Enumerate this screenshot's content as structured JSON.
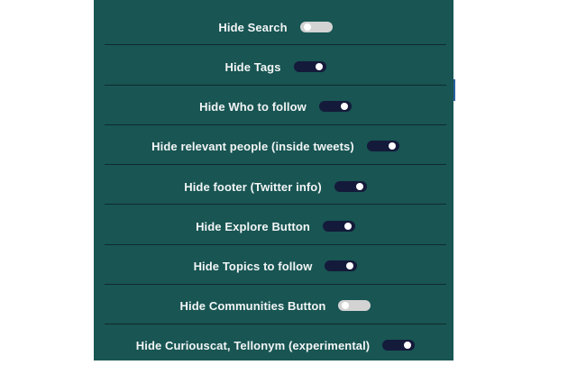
{
  "settings": [
    {
      "label": "Hide Search",
      "enabled": false
    },
    {
      "label": "Hide Tags",
      "enabled": true
    },
    {
      "label": "Hide Who to follow",
      "enabled": true
    },
    {
      "label": "Hide relevant people (inside tweets)",
      "enabled": true
    },
    {
      "label": "Hide footer (Twitter info)",
      "enabled": true
    },
    {
      "label": "Hide Explore Button",
      "enabled": true
    },
    {
      "label": "Hide Topics to follow",
      "enabled": true
    },
    {
      "label": "Hide Communities Button",
      "enabled": false
    },
    {
      "label": "Hide Curiouscat, Tellonym (experimental)",
      "enabled": true
    }
  ],
  "colors": {
    "panel": "#185553",
    "toggle_on": "#141a3a",
    "toggle_off": "#d3d3d3",
    "knob": "#ffffff",
    "text": "#f2f5f5"
  }
}
